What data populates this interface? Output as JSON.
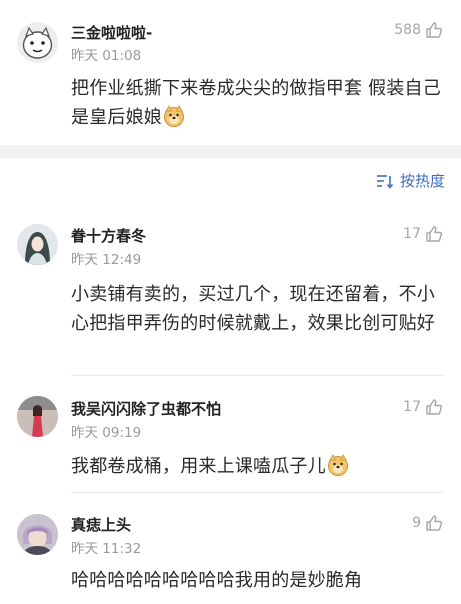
{
  "top_comment": {
    "username": "三金啦啦啦-",
    "time": "昨天 01:08",
    "likes": "588",
    "content": "把作业纸撕下来卷成尖尖的做指甲套 假装自己是皇后娘娘"
  },
  "sort": {
    "label": "按热度",
    "icon": "sort-icon"
  },
  "comments": [
    {
      "username": "眷十方春冬",
      "time": "昨天 12:49",
      "likes": "17",
      "content": "小卖铺有卖的，买过几个，现在还留着，不小心把指甲弄伤的时候就戴上，效果比创可贴好"
    },
    {
      "username": "我吴闪闪除了虫都不怕",
      "time": "昨天 09:19",
      "likes": "17",
      "content": "我都卷成桶，用来上课嗑瓜子儿"
    },
    {
      "username": "真痣上头",
      "time": "昨天 11:32",
      "likes": "9",
      "content": "哈哈哈哈哈哈哈哈哈我用的是妙脆角"
    }
  ],
  "colors": {
    "accent": "#3f6ec1",
    "meta": "#9a9a9a",
    "like": "#a6a6a6",
    "band": "#f2f2f2"
  }
}
